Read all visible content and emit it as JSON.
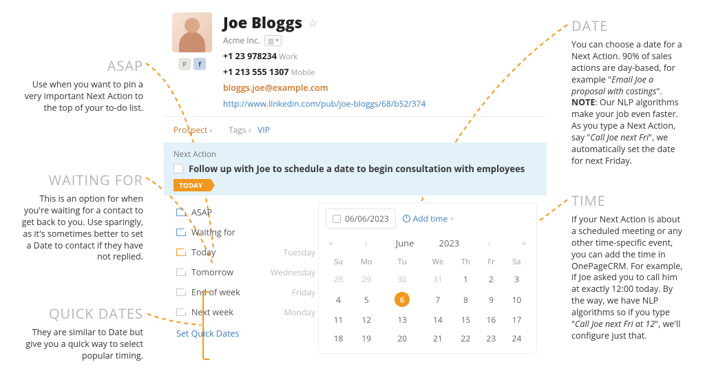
{
  "annotations": {
    "asap": {
      "title": "ASAP",
      "body": "Use when you want to pin a very important Next Action to the top of your to-do list."
    },
    "waiting": {
      "title": "WAITING FOR",
      "body": "This is an option for when you're waiting for a contact to get back to you. Use sparingly, as it's sometimes better to set a Date to contact if they have not replied."
    },
    "quick": {
      "title": "QUICK DATES",
      "body": "They are similar to Date but give you a quick way to select popular timing."
    },
    "date": {
      "title": "DATE",
      "body_pre": "You can choose a date for a Next Action. 90% of sales actions are day-based, for example \"",
      "body_em1": "Email Joe a proposal with costings",
      "body_mid": "\". ",
      "body_note": "NOTE",
      "body_mid2": ": Our NLP algorithms make your job even faster. As you type a Next Action, say \"",
      "body_em2": "Call Joe next Fri",
      "body_post": "\", we automatically set the date for next Friday."
    },
    "time": {
      "title": "TIME",
      "body_pre": "If your Next Action is about a scheduled meeting or any other time-specific event, you can add the time in OnePageCRM. For example, if Joe asked you to call him at exactly 12:00 today. By the way, we have NLP algorithms so if you type \"",
      "body_em": "Call Joe next Fri at 12",
      "body_post": "\", we'll configure just that."
    }
  },
  "contact": {
    "name": "Joe Bloggs",
    "company": "Acme Inc.",
    "phone1": "+1 23 978234",
    "phone1_label": "Work",
    "phone2": "+1 213 555 1307",
    "phone2_label": "Mobile",
    "email": "bloggs.joe@example.com",
    "linkedin": "http://www.linkedin.com/pub/joe-bloggs/68/b52/374",
    "status": "Prospect",
    "tags_label": "Tags",
    "tag_vip": "VIP"
  },
  "next_action": {
    "section": "Next Action",
    "text": "Follow up with Joe to schedule a date to begin consultation with employees",
    "today_badge": "TODAY"
  },
  "quick_dates": {
    "items": [
      {
        "label": "ASAP",
        "day": "",
        "flag": "blue"
      },
      {
        "label": "Waiting for",
        "day": "",
        "flag": "blue"
      },
      {
        "label": "Today",
        "day": "Tuesday",
        "flag": "orange"
      },
      {
        "label": "Tomorrow",
        "day": "Wednesday",
        "flag": "gray"
      },
      {
        "label": "End of week",
        "day": "Friday",
        "flag": "gray"
      },
      {
        "label": "Next week",
        "day": "Monday",
        "flag": "gray"
      }
    ],
    "set_link": "Set Quick Dates"
  },
  "calendar": {
    "date_field": "06/06/2023",
    "add_time": "Add time",
    "month": "June",
    "year": "2023",
    "dow": [
      "Su",
      "Mo",
      "Tu",
      "We",
      "Th",
      "Fr",
      "Sa"
    ],
    "weeks": [
      [
        {
          "d": "28",
          "m": 1
        },
        {
          "d": "29",
          "m": 1
        },
        {
          "d": "30",
          "m": 1
        },
        {
          "d": "31",
          "m": 1
        },
        {
          "d": "1"
        },
        {
          "d": "2"
        },
        {
          "d": "3"
        }
      ],
      [
        {
          "d": "4"
        },
        {
          "d": "5"
        },
        {
          "d": "6",
          "sel": 1
        },
        {
          "d": "7"
        },
        {
          "d": "8"
        },
        {
          "d": "9"
        },
        {
          "d": "10"
        }
      ],
      [
        {
          "d": "11"
        },
        {
          "d": "12"
        },
        {
          "d": "13"
        },
        {
          "d": "14"
        },
        {
          "d": "15"
        },
        {
          "d": "16"
        },
        {
          "d": "17"
        }
      ],
      [
        {
          "d": "18"
        },
        {
          "d": "19"
        },
        {
          "d": "20"
        },
        {
          "d": "21"
        },
        {
          "d": "22"
        },
        {
          "d": "23"
        },
        {
          "d": "24"
        }
      ]
    ],
    "nav": {
      "prev2": "«",
      "prev": "‹",
      "next": "›",
      "next2": "»"
    }
  }
}
